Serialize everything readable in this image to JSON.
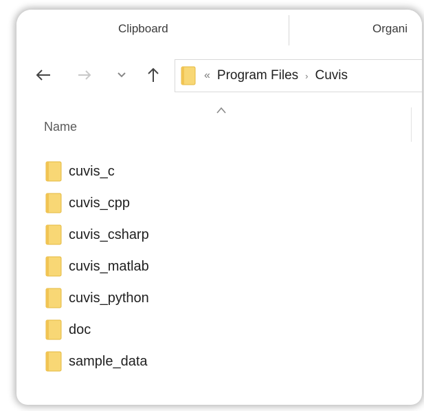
{
  "ribbon": {
    "groups": [
      "Clipboard",
      "Organi"
    ]
  },
  "nav": {
    "back_icon": "arrow-left-icon",
    "forward_icon": "arrow-right-icon",
    "recent_icon": "chevron-down-icon",
    "up_icon": "arrow-up-icon",
    "address": {
      "overflow_chevrons": "«",
      "crumbs": [
        "Program Files",
        "Cuvis"
      ],
      "separator": "›"
    }
  },
  "file_list": {
    "column_header": "Name",
    "sort_icon": "chevron-up-icon",
    "items": [
      {
        "name": "cuvis_c",
        "type": "folder"
      },
      {
        "name": "cuvis_cpp",
        "type": "folder"
      },
      {
        "name": "cuvis_csharp",
        "type": "folder"
      },
      {
        "name": "cuvis_matlab",
        "type": "folder"
      },
      {
        "name": "cuvis_python",
        "type": "folder"
      },
      {
        "name": "doc",
        "type": "folder"
      },
      {
        "name": "sample_data",
        "type": "folder"
      }
    ]
  },
  "colors": {
    "folder_fill": "#f8d775",
    "folder_edge": "#e4b93f",
    "arrow_active": "#444444",
    "arrow_disabled": "#c8c8c8"
  }
}
